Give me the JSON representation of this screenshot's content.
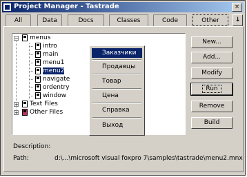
{
  "window": {
    "title": "Project Manager - Tastrade",
    "close_label": "×"
  },
  "tabs": [
    {
      "label": "All"
    },
    {
      "label": "Data"
    },
    {
      "label": "Docs"
    },
    {
      "label": "Classes"
    },
    {
      "label": "Code"
    },
    {
      "label": "Other"
    }
  ],
  "tab_scroll_label": "↓",
  "tree": {
    "root_label": "menus",
    "children": [
      "intro",
      "main",
      "menu1",
      "menu2",
      "navigate",
      "ordentry",
      "window"
    ],
    "text_files_label": "Text Files",
    "other_files_label": "Other Files",
    "selected": "menu2"
  },
  "context_menu": {
    "items": [
      "Заказчики",
      "Продавцы",
      "Товар",
      "Цена",
      "Справка",
      "Выход"
    ],
    "highlighted": "Заказчики"
  },
  "buttons": {
    "new": "New...",
    "add": "Add...",
    "modify": "Modify",
    "run": "Run",
    "remove": "Remove",
    "build": "Build"
  },
  "info": {
    "description_label": "Description:",
    "path_label": "Path:",
    "path_value": "d:\\...\\microsoft visual foxpro 7\\samples\\tastrade\\menu2.mnx"
  },
  "colors": {
    "title_start": "#0a246a",
    "title_end": "#a6caf0",
    "selection": "#0a246a",
    "face": "#d4d0c8"
  }
}
